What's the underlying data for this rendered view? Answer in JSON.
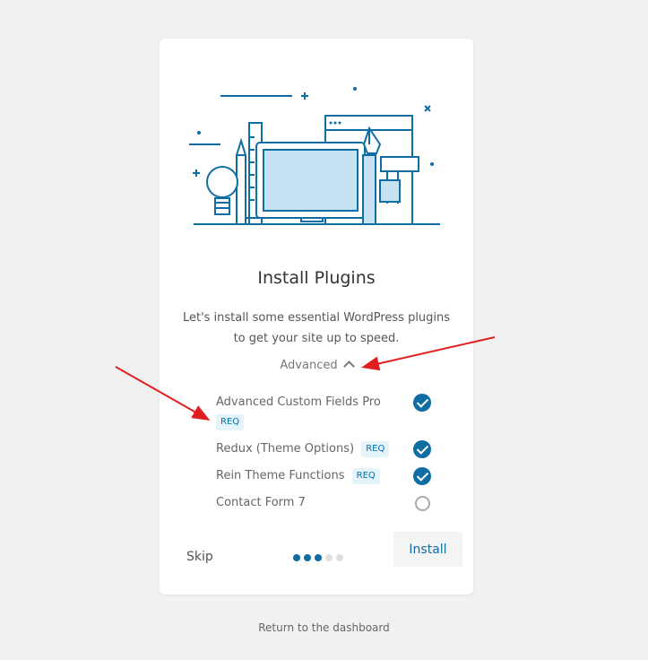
{
  "card": {
    "title": "Install Plugins",
    "description": "Let's install some essential WordPress plugins to get your site up to speed.",
    "advanced_label": "Advanced",
    "plugins": [
      {
        "name": "Advanced Custom Fields Pro",
        "badge": "REQ",
        "checked": true
      },
      {
        "name": "Redux (Theme Options)",
        "badge": "REQ",
        "checked": true
      },
      {
        "name": "Rein Theme Functions",
        "badge": "REQ",
        "checked": true
      },
      {
        "name": "Contact Form 7",
        "badge": "",
        "checked": false
      }
    ],
    "skip_label": "Skip",
    "install_label": "Install",
    "progress": {
      "current_step": 3,
      "total_steps": 5
    }
  },
  "return_link": "Return to the dashboard",
  "colors": {
    "accent": "#0e6ea3",
    "badge_bg": "#e5f3fa",
    "annotation": "#e02020"
  }
}
